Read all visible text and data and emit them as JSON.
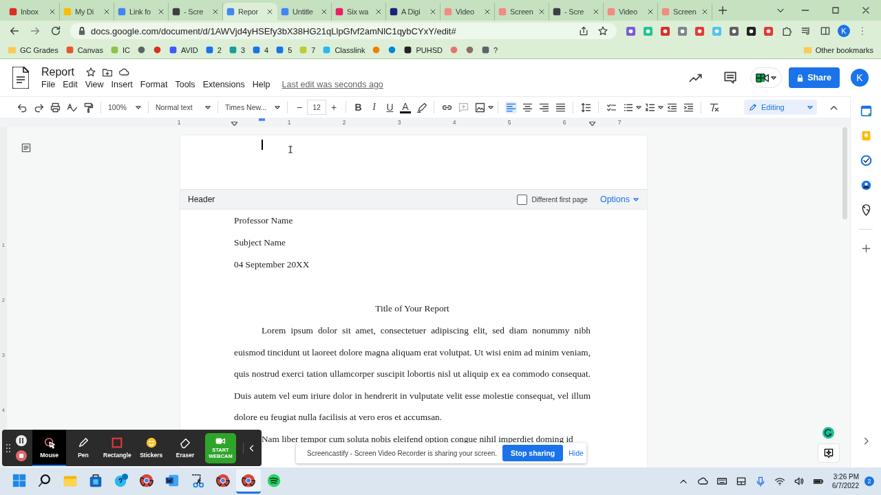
{
  "browser": {
    "tabs": [
      {
        "label": "Inbox",
        "color": "#d93025",
        "selected": false
      },
      {
        "label": "My Di",
        "color": "#fbbc04",
        "selected": false
      },
      {
        "label": "Link fo",
        "color": "#4285f4",
        "selected": false
      },
      {
        "label": "- Scre",
        "color": "#3c4043",
        "selected": false
      },
      {
        "label": "Repor",
        "color": "#4285f4",
        "selected": true
      },
      {
        "label": "Untitle",
        "color": "#4285f4",
        "selected": false
      },
      {
        "label": "Six wa",
        "color": "#e91e63",
        "selected": false
      },
      {
        "label": "A Digi",
        "color": "#1a237e",
        "selected": false
      },
      {
        "label": "Video",
        "color": "#f28b82",
        "selected": false
      },
      {
        "label": "Screen",
        "color": "#f28b82",
        "selected": false
      },
      {
        "label": "- Scre",
        "color": "#3c4043",
        "selected": false
      },
      {
        "label": "Video",
        "color": "#f28b82",
        "selected": false
      },
      {
        "label": "Screen",
        "color": "#f28b82",
        "selected": false
      }
    ],
    "address": "docs.google.com/document/d/1AWVjd4yHSEfy3bX38HG21qLlpGfvf2amNlC1qybCYxY/edit#",
    "avatar": "K",
    "bookmarks": [
      {
        "kind": "folder",
        "label": "GC Grades",
        "color": "#f9cb55"
      },
      {
        "kind": "site",
        "label": "Canvas",
        "color": "#e4572e"
      },
      {
        "kind": "site",
        "label": "IC",
        "color": "#8bc34a"
      },
      {
        "kind": "icon",
        "color": "#5f6368"
      },
      {
        "kind": "icon",
        "color": "#d93025"
      },
      {
        "kind": "site",
        "label": "AVID",
        "color": "#3d5afe"
      },
      {
        "kind": "site",
        "label": "2",
        "color": "#1a73e8"
      },
      {
        "kind": "site",
        "label": "3",
        "color": "#1a9e9a"
      },
      {
        "kind": "site",
        "label": "4",
        "color": "#1a73e8"
      },
      {
        "kind": "site",
        "label": "5",
        "color": "#1a73e8"
      },
      {
        "kind": "site",
        "label": "7",
        "color": "#c0ca33"
      },
      {
        "kind": "site",
        "label": "Classlink",
        "color": "#29b6f6"
      },
      {
        "kind": "icon",
        "color": "#f57c00"
      },
      {
        "kind": "icon",
        "color": "#0288d1"
      },
      {
        "kind": "site",
        "label": "PUHSD",
        "color": "#222222"
      },
      {
        "kind": "icon",
        "color": "#e57373"
      },
      {
        "kind": "icon",
        "color": "#8d6e63"
      },
      {
        "kind": "site",
        "label": "?",
        "color": "#5f6368"
      }
    ],
    "other_bookmarks": "Other bookmarks"
  },
  "docs": {
    "title": "Report",
    "menu": [
      "File",
      "Edit",
      "View",
      "Insert",
      "Format",
      "Tools",
      "Extensions",
      "Help"
    ],
    "last_edit": "Last edit was seconds ago",
    "share": "Share",
    "avatar": "K",
    "toolbar": {
      "zoom": "100%",
      "style": "Normal text",
      "font": "Times New...",
      "size": "12",
      "minus": "−",
      "plus": "+",
      "format": [
        {
          "kind": "bold",
          "label": "B"
        },
        {
          "kind": "italic",
          "label": "I"
        },
        {
          "kind": "underline",
          "label": "U"
        },
        {
          "kind": "color",
          "label": "A"
        }
      ],
      "alignment": [
        {
          "kind": "left",
          "selected": true
        },
        {
          "kind": "center",
          "selected": false
        },
        {
          "kind": "right",
          "selected": false
        },
        {
          "kind": "justify",
          "selected": false
        }
      ],
      "mode": "Editing"
    },
    "ruler": [
      "1",
      "1",
      "2",
      "3",
      "4",
      "5",
      "6",
      "7"
    ],
    "vertical_ruler": [
      "1",
      "2",
      "3",
      "4"
    ]
  },
  "header_bar": {
    "label": "Header",
    "different_first_page": {
      "label": "Different first page",
      "checked": false
    },
    "options": "Options"
  },
  "document": {
    "header_lines": [
      "Professor Name",
      "Subject Name",
      "04 September 20XX"
    ],
    "title": "Title of Your Report",
    "paragraphs": [
      "Lorem ipsum dolor sit amet, consectetuer adipiscing elit, sed diam nonummy nibh euismod tincidunt ut laoreet dolore magna aliquam erat volutpat. Ut wisi enim ad minim veniam, quis nostrud exerci tation ullamcorper suscipit lobortis nisl ut aliquip ex ea commodo consequat. Duis autem vel eum iriure dolor in hendrerit in vulputate velit esse molestie consequat, vel illum dolore eu feugiat nulla facilisis at vero eros et accumsan.",
      "Nam liber tempor cum soluta nobis eleifend option congue nihil imperdiet doming id"
    ]
  },
  "screencastify": {
    "tools": [
      {
        "kind": "mouse",
        "label": "Mouse",
        "selected": true
      },
      {
        "kind": "pen",
        "label": "Pen",
        "selected": false
      },
      {
        "kind": "rectangle",
        "label": "Rectangle",
        "selected": false
      },
      {
        "kind": "stickers",
        "label": "Stickers",
        "selected": false
      },
      {
        "kind": "eraser",
        "label": "Eraser",
        "selected": false
      }
    ],
    "webcam": "START WEBCAM"
  },
  "sharing_banner": {
    "message": "Screencastify - Screen Video Recorder is sharing your screen.",
    "stop": "Stop sharing",
    "hide": "Hide"
  },
  "taskbar": {
    "apps": [
      {
        "kind": "start",
        "selected": false
      },
      {
        "kind": "search",
        "selected": false
      },
      {
        "kind": "files",
        "selected": false
      },
      {
        "kind": "store",
        "selected": false
      },
      {
        "kind": "help",
        "selected": false
      },
      {
        "kind": "chrome",
        "selected": false
      },
      {
        "kind": "word",
        "selected": false
      },
      {
        "kind": "snip",
        "selected": false
      },
      {
        "kind": "chrome",
        "selected": false
      },
      {
        "kind": "chrome",
        "selected": true
      },
      {
        "kind": "spotify",
        "selected": false
      }
    ],
    "time": "3:26 PM",
    "date": "6/7/2022",
    "notifications": "2"
  }
}
